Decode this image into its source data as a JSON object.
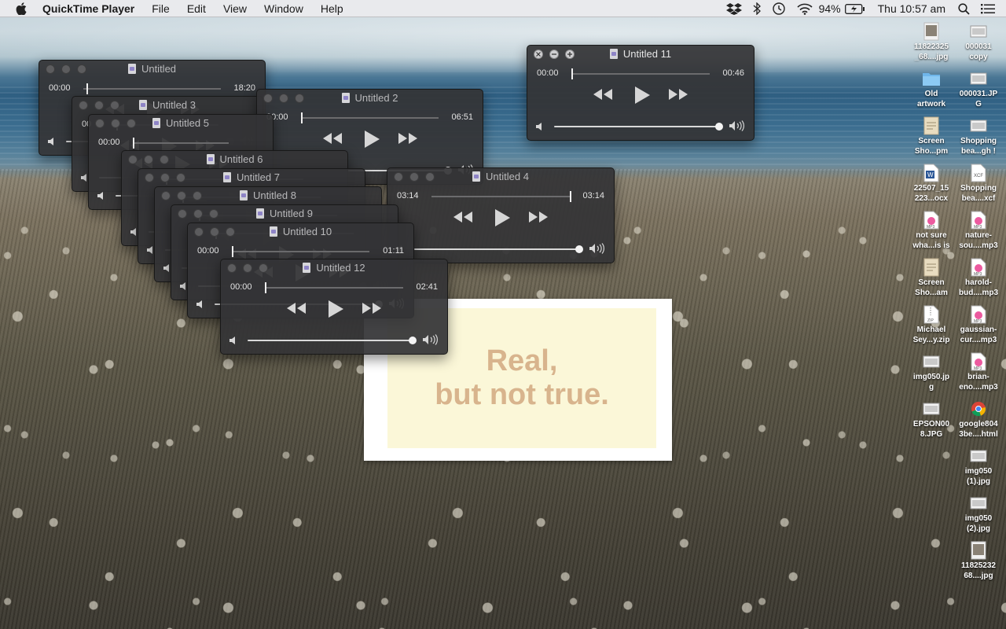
{
  "menubar": {
    "app_name": "QuickTime Player",
    "menus": [
      "File",
      "Edit",
      "View",
      "Window",
      "Help"
    ],
    "battery": "94%",
    "clock": "Thu 10:57 am"
  },
  "windows": [
    {
      "id": "w1",
      "title": "Untitled",
      "current": "00:00",
      "duration": "18:20",
      "front": false
    },
    {
      "id": "w3",
      "title": "Untitled 3",
      "current": "00",
      "duration": "",
      "front": false
    },
    {
      "id": "w2",
      "title": "Untitled 2",
      "current": "00:00",
      "duration": "06:51",
      "front": false
    },
    {
      "id": "w5",
      "title": "Untitled 5",
      "current": "00:00",
      "duration": "",
      "front": false
    },
    {
      "id": "w4",
      "title": "Untitled 4",
      "current": "03:14",
      "duration": "03:14",
      "front": false
    },
    {
      "id": "w6",
      "title": "Untitled 6",
      "current": "",
      "duration": "",
      "front": false
    },
    {
      "id": "w7",
      "title": "Untitled 7",
      "current": "",
      "duration": "",
      "front": false
    },
    {
      "id": "w8",
      "title": "Untitled 8",
      "current": "",
      "duration": "",
      "front": false
    },
    {
      "id": "w9",
      "title": "Untitled 9",
      "current": "",
      "duration": "",
      "front": false
    },
    {
      "id": "w10",
      "title": "Untitled 10",
      "current": "00:00",
      "duration": "01:11",
      "front": false
    },
    {
      "id": "w12",
      "title": "Untitled 12",
      "current": "00:00",
      "duration": "02:41",
      "front": false
    },
    {
      "id": "w11",
      "title": "Untitled 11",
      "current": "00:00",
      "duration": "00:46",
      "front": true
    }
  ],
  "note": {
    "line1": "Real,",
    "line2": "but not true."
  },
  "desktop_icons": [
    {
      "line1": "11822325",
      "line2": "_68....jpg",
      "icon": "photo-icon"
    },
    {
      "line1": "000031",
      "line2": "copy",
      "icon": "image-file-icon"
    },
    {
      "line1": "Old",
      "line2": "artwork",
      "icon": "folder-icon"
    },
    {
      "line1": "000031.JP",
      "line2": "G",
      "icon": "image-file-icon"
    },
    {
      "line1": "Screen",
      "line2": "Sho...pm",
      "icon": "screenshot-icon"
    },
    {
      "line1": "Shopping",
      "line2": "bea...gh !",
      "icon": "image-file-icon"
    },
    {
      "line1": "22507_15",
      "line2": "223...ocx",
      "icon": "word-doc-icon"
    },
    {
      "line1": "Shopping",
      "line2": "bea....xcf",
      "icon": "xcf-file-icon"
    },
    {
      "line1": "not sure",
      "line2": "wha...is is",
      "icon": "audio-file-icon"
    },
    {
      "line1": "nature-",
      "line2": "sou....mp3",
      "icon": "audio-file-icon"
    },
    {
      "line1": "Screen",
      "line2": "Sho...am",
      "icon": "screenshot-icon"
    },
    {
      "line1": "harold-",
      "line2": "bud....mp3",
      "icon": "audio-file-icon"
    },
    {
      "line1": "Michael",
      "line2": "Sey...y.zip",
      "icon": "zip-file-icon"
    },
    {
      "line1": "gaussian-",
      "line2": "cur....mp3",
      "icon": "audio-file-icon"
    },
    {
      "line1": "img050.jp",
      "line2": "g",
      "icon": "image-file-icon"
    },
    {
      "line1": "brian-",
      "line2": "eno....mp3",
      "icon": "audio-file-icon"
    },
    {
      "line1": "EPSON00",
      "line2": "8.JPG",
      "icon": "image-file-icon"
    },
    {
      "line1": "google804",
      "line2": "3be....html",
      "icon": "chrome-html-icon"
    },
    {
      "line1": "img050",
      "line2": "(1).jpg",
      "icon": "image-file-icon"
    },
    {
      "line1": "img050",
      "line2": "(2).jpg",
      "icon": "image-file-icon"
    },
    {
      "line1": "11825232",
      "line2": "68....jpg",
      "icon": "photo-icon"
    }
  ]
}
